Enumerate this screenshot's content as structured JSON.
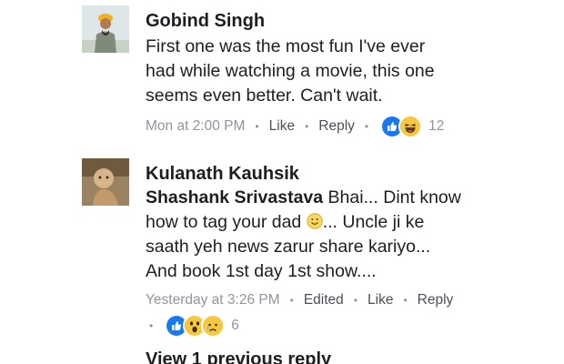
{
  "comments": [
    {
      "author": "Gobind Singh",
      "lines": [
        "First one was the most fun I've ever",
        "had while watching a movie, this one",
        "seems even better. Can't wait."
      ],
      "time": "Mon at 2:00 PM",
      "like": "Like",
      "reply": "Reply",
      "reaction_icons": [
        "like-reaction-icon",
        "haha-reaction-icon"
      ],
      "reaction_count": "12"
    },
    {
      "author": "Kulanath Kauhsik",
      "mention": "Shashank Srivastava",
      "line1_rest": " Bhai... Dint know",
      "line2_a": "how to tag your dad ",
      "line2_b": "... Uncle ji ke",
      "line3": "saath yeh news zarur share kariyo...",
      "line4": "And book 1st day 1st show....",
      "time": "Yesterday at 3:26 PM",
      "edited": "Edited",
      "like": "Like",
      "reply": "Reply",
      "reaction_icons": [
        "like-reaction-icon",
        "wow-reaction-icon",
        "sad-reaction-icon"
      ],
      "reaction_count": "6"
    }
  ],
  "view_replies": "View 1 previous reply",
  "colors": {
    "like_blue": "#1877f2",
    "emoji_yellow": "#f7c740",
    "text": "#1c1e21",
    "meta": "#90949c"
  }
}
